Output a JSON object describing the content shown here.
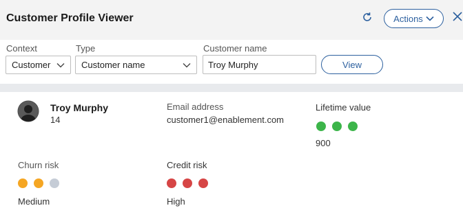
{
  "header": {
    "title": "Customer Profile Viewer",
    "actions_label": "Actions"
  },
  "filters": {
    "context": {
      "label": "Context",
      "value": "Customer"
    },
    "type": {
      "label": "Type",
      "value": "Customer name"
    },
    "customer_name": {
      "label": "Customer name",
      "value": "Troy Murphy"
    },
    "view_label": "View"
  },
  "profile": {
    "name": "Troy Murphy",
    "id": "14",
    "email": {
      "label": "Email address",
      "value": "customer1@enablement.com"
    },
    "lifetime": {
      "label": "Lifetime value",
      "value": "900",
      "dots": [
        "#3cb54a",
        "#3cb54a",
        "#3cb54a"
      ]
    },
    "churn": {
      "label": "Churn risk",
      "value": "Medium",
      "dots": [
        "#f5a623",
        "#f5a623",
        "#c5ccd6"
      ]
    },
    "credit": {
      "label": "Credit risk",
      "value": "High",
      "dots": [
        "#d64545",
        "#d64545",
        "#d64545"
      ]
    }
  },
  "icons": {
    "refresh": "refresh-icon",
    "chevron": "chevron-down-icon",
    "close": "close-icon",
    "avatar": "user-avatar-icon"
  },
  "colors": {
    "accent": "#2b5f9e",
    "header_bg": "#f3f3f3",
    "band_bg": "#e8eaed"
  }
}
